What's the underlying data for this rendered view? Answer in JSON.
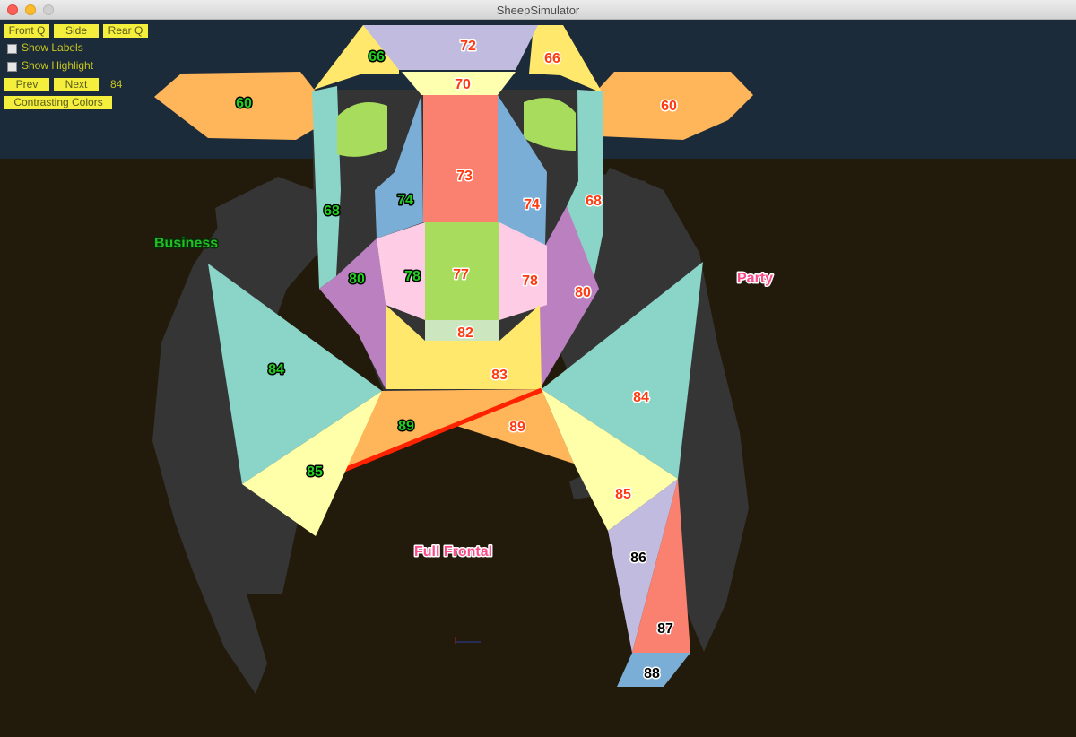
{
  "window": {
    "title": "SheepSimulator"
  },
  "controls": {
    "front_q": "Front Q",
    "side": "Side",
    "rear_q": "Rear Q",
    "show_labels": "Show Labels",
    "show_highlight": "Show Highlight",
    "prev": "Prev",
    "next": "Next",
    "current_panel": "84",
    "contrasting_colors": "Contrasting Colors"
  },
  "scene": {
    "section_labels": {
      "business": "Business",
      "party": "Party",
      "full_frontal": "Full Frontal"
    },
    "panel_numbers": {
      "ear_left": "60",
      "ear_right": "60",
      "top_left": "66",
      "top_right": "66",
      "crown": "72",
      "brow": "70",
      "cheek_left": "68",
      "cheek_right": "68",
      "eye_side_left": "74",
      "eye_side_right": "74",
      "nose": "73",
      "jaw_left": "80",
      "jaw_right": "80",
      "muzzle_left": "78",
      "muzzle_right": "78",
      "muzzle_center": "77",
      "chin": "82",
      "neck": "83",
      "chest_left": "89",
      "chest_right": "89",
      "shoulder_left": "84",
      "shoulder_right": "84",
      "leg_left": "85",
      "leg_right": "85",
      "leg_mid": "86",
      "leg_low": "87",
      "hoof": "88"
    }
  }
}
